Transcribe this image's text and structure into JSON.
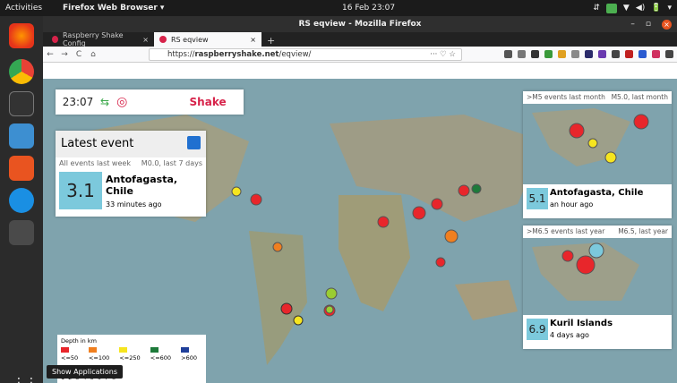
{
  "topbar": {
    "activities": "Activities",
    "app": "Firefox Web Browser ▾",
    "clock": "16 Feb 23:07",
    "tray": [
      "⇵",
      "☐",
      "▼",
      "◀)",
      "🔋",
      "▾"
    ]
  },
  "window": {
    "title": "RS eqview - Mozilla Firefox",
    "minimize": "–",
    "maximize": "▫",
    "close": "×"
  },
  "tabs": [
    {
      "label": "Raspberry Shake Config",
      "close": "×"
    },
    {
      "label": "RS eqview",
      "close": "×"
    }
  ],
  "new_tab": "+",
  "nav": {
    "back": "←",
    "forward": "→",
    "reload": "C",
    "home": "⌂",
    "url_prefix": "https://",
    "url_domain": "raspberryshake.net",
    "url_path": "/eqview/",
    "dots": "··· ♡ ☆"
  },
  "page": {
    "time": "23:07",
    "logo": {
      "a": "Raspberry",
      "b": "Shake"
    },
    "latest": {
      "title": "Latest event",
      "filter_left": "All events last week",
      "filter_right": "M0.0, last 7 days",
      "magnitude": "3.1",
      "place": "Antofagasta, Chile",
      "ago": "33 minutes ago"
    },
    "month": {
      "left": ">M5 events last month",
      "right": "M5.0, last month",
      "magnitude": "5.1",
      "place": "Antofagasta, Chile",
      "ago": "an hour ago"
    },
    "year": {
      "left": ">M6.5 events last year",
      "right": "M6.5, last year",
      "magnitude": "6.9",
      "place": "Kuril Islands",
      "ago": "4 days ago"
    },
    "legend": {
      "depth_title": "Depth in km",
      "depth": [
        "<=50",
        "<=100",
        "<=250",
        "<=600",
        ">600"
      ],
      "mag_title": "Magnitude",
      "mags": [
        "1",
        "2",
        "3",
        "4",
        "5",
        "6",
        "7",
        "8"
      ]
    }
  },
  "tooltip": "Show Applications",
  "colors": {
    "d50": "#e8262b",
    "d100": "#f07f1f",
    "d250": "#f6e51f",
    "d600": "#1d7a3a",
    "d600p": "#1f3f9a",
    "mag": "#7cc9dc"
  }
}
